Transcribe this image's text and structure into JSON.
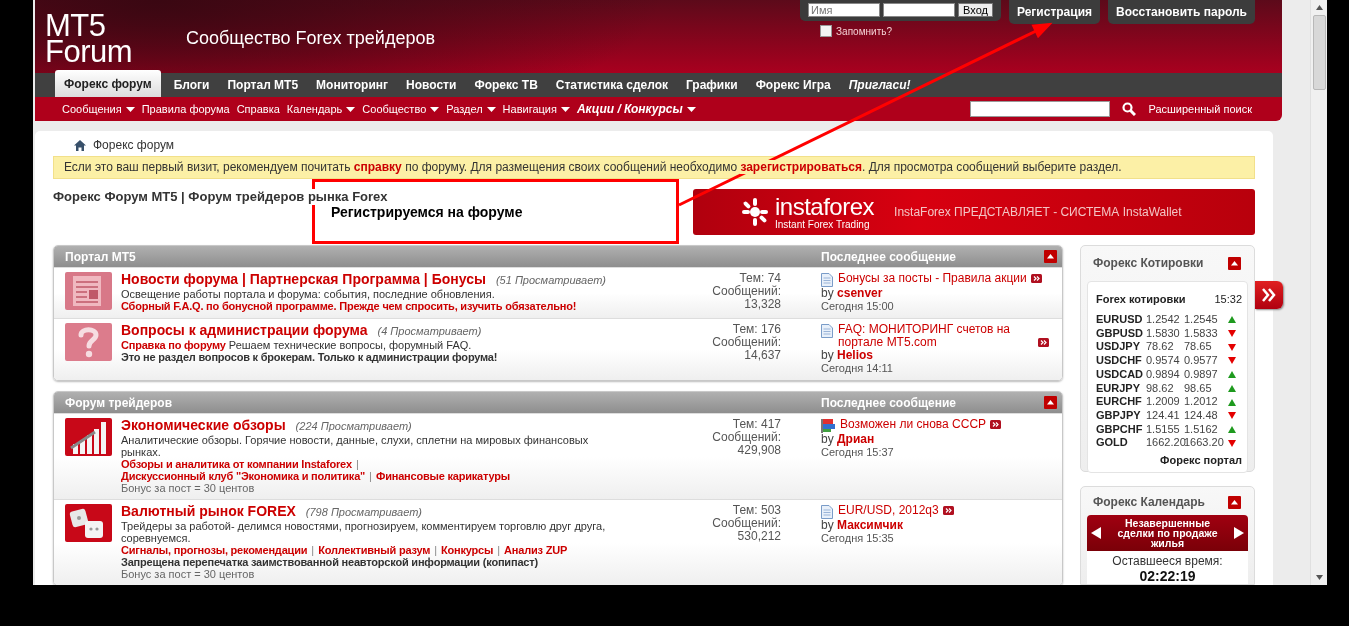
{
  "header": {
    "logo": "MT5 Forum",
    "tagline": "Сообщество Forex трейдеров",
    "login": {
      "username_placeholder": "Имя",
      "submit": "Вход",
      "remember": {
        "label": "Запомнить?",
        "checked": false
      }
    },
    "buttons": [
      "Регистрация",
      "Восстановить пароль"
    ]
  },
  "nav_tabs": [
    {
      "label": "Форекс форум",
      "selected": true,
      "kind": "link"
    },
    {
      "label": "Блоги",
      "selected": false,
      "kind": "link"
    },
    {
      "label": "Портал MT5",
      "selected": false,
      "kind": "link"
    },
    {
      "label": "Мониторинг",
      "selected": false,
      "kind": "link"
    },
    {
      "label": "Новости",
      "selected": false,
      "kind": "link"
    },
    {
      "label": "Форекс ТВ",
      "selected": false,
      "kind": "link"
    },
    {
      "label": "Статистика сделок",
      "selected": false,
      "kind": "link"
    },
    {
      "label": "Графики",
      "selected": false,
      "kind": "link"
    },
    {
      "label": "Форекс Игра",
      "selected": false,
      "kind": "link"
    },
    {
      "label": "Пригласи!",
      "selected": false,
      "kind": "promo"
    }
  ],
  "subnav": [
    {
      "label": "Сообщения",
      "dropdown": true,
      "kind": "link"
    },
    {
      "label": "Правила форума",
      "dropdown": false,
      "kind": "link"
    },
    {
      "label": "Справка",
      "dropdown": false,
      "kind": "link"
    },
    {
      "label": "Календарь",
      "dropdown": true,
      "kind": "link"
    },
    {
      "label": "Сообщество",
      "dropdown": true,
      "kind": "link"
    },
    {
      "label": "Раздел",
      "dropdown": true,
      "kind": "link"
    },
    {
      "label": "Навигация",
      "dropdown": true,
      "kind": "link"
    },
    {
      "label": "Акции / Конкурсы",
      "dropdown": true,
      "kind": "promo"
    }
  ],
  "search": {
    "advanced": "Расширенный поиск"
  },
  "breadcrumb": "Форекс форум",
  "notice": [
    {
      "kind": "text",
      "text": "Если это ваш первый визит, рекомендуем почитать "
    },
    {
      "kind": "link",
      "text": "справку"
    },
    {
      "kind": "text",
      "text": " по форуму. Для размещения своих сообщений необходимо "
    },
    {
      "kind": "link",
      "text": "зарегистрироваться"
    },
    {
      "kind": "text",
      "text": ". Для просмотра сообщений выберите раздел."
    }
  ],
  "page_title": "Форекс Форум MT5 | Форум трейдеров рынка Forex",
  "banner": {
    "brand": "instaforex",
    "slogan": "Instant Forex Trading",
    "headline": "InstaForex ПРЕДСТАВЛЯЕТ - СИСТЕМА InstaWallet"
  },
  "annotation": "Регистрируемся на форуме",
  "categories": [
    {
      "title": "Портал MT5",
      "last_post_header": "Последнее сообщение",
      "forums": [
        {
          "kind": "news",
          "title": "Новости форума | Партнерская Программа | Бонусы",
          "viewers": "(51 Просматривает)",
          "lines": [
            {
              "kind": "desc",
              "text": "Освещение работы портала и форума: события, последние обновления."
            },
            {
              "kind": "link",
              "text": "Сборный F.A.Q. по бонусной программе. Прежде чем спросить, изучить обязательно!"
            }
          ],
          "topics": "Тем: 74",
          "posts_label": "Сообщений:",
          "posts": "13,328",
          "last_post": {
            "kind": "document",
            "title": "Бонусы за посты - Правила акции",
            "by": "by",
            "author": "csenver",
            "time": "Сегодня 15:00"
          }
        },
        {
          "kind": "help",
          "title": "Вопросы к администрации форума",
          "viewers": "(4 Просматривает)",
          "lines": [
            {
              "kind": "link_desc",
              "link": "Справка по форуму",
              "text": "Решаем технические вопросы, форумный FAQ."
            },
            {
              "kind": "note",
              "text": "Это не раздел вопросов к брокерам. Только к администрации форума!"
            }
          ],
          "topics": "Тем: 176",
          "posts_label": "Сообщений:",
          "posts": "14,637",
          "last_post": {
            "kind": "document",
            "title": "FAQ: МОНИТОРИНГ счетов на портале MT5.com",
            "by": "by",
            "author": "Helios",
            "time": "Сегодня 14:11"
          }
        }
      ]
    },
    {
      "title": "Форум трейдеров",
      "last_post_header": "Последнее сообщение",
      "forums": [
        {
          "kind": "analysis",
          "title": "Экономические обзоры",
          "viewers": "(224 Просматривает)",
          "lines": [
            {
              "kind": "desc",
              "text": "Аналитические обзоры. Горячие новости, данные, слухи, сплетни на мировых финансовых рынках."
            },
            {
              "kind": "links",
              "separator": "|",
              "items": [
                "Обзоры и аналитика от компании Instaforex",
                "Дискуссионный клуб \"Экономика и политика\"",
                "Финансовые карикатуры"
              ]
            },
            {
              "kind": "bonus",
              "text": "Бонус за пост = 30 центов"
            }
          ],
          "topics": "Тем: 417",
          "posts_label": "Сообщений:",
          "posts": "429,908",
          "last_post": {
            "kind": "flag",
            "title": "Возможен ли снова СССР",
            "by": "by",
            "author": "Дриан",
            "time": "Сегодня 15:37"
          }
        },
        {
          "kind": "market",
          "title": "Валютный рынок FOREX",
          "viewers": "(798 Просматривает)",
          "lines": [
            {
              "kind": "desc",
              "text": "Трейдеры за работой- делимся новостями, прогнозируем, комментируем торговлю друг друга, соревнуемся."
            },
            {
              "kind": "links",
              "separator": "|",
              "items": [
                "Сигналы, прогнозы, рекомендации",
                "Коллективный разум",
                "Конкурсы",
                "Анализ ZUP"
              ]
            },
            {
              "kind": "note",
              "text": "Запрещена перепечатка заимствованной неавторской информации (копипаст)"
            },
            {
              "kind": "bonus",
              "text": "Бонус за пост = 30 центов"
            }
          ],
          "topics": "Тем: 503",
          "posts_label": "Сообщений:",
          "posts": "530,212",
          "last_post": {
            "kind": "document",
            "title": "EUR/USD, 2012q3",
            "by": "by",
            "author": "Максимчик",
            "time": "Сегодня 15:35"
          }
        }
      ]
    }
  ],
  "quotes": {
    "title": "Форекс Котировки",
    "heading": "Forex котировки",
    "time": "15:32",
    "rows": [
      {
        "symbol": "EURUSD",
        "bid": "1.2542",
        "ask": "1.2545",
        "rising": true
      },
      {
        "symbol": "GBPUSD",
        "bid": "1.5830",
        "ask": "1.5833",
        "rising": false
      },
      {
        "symbol": "USDJPY",
        "bid": "78.62",
        "ask": "78.65",
        "rising": false
      },
      {
        "symbol": "USDCHF",
        "bid": "0.9574",
        "ask": "0.9577",
        "rising": false
      },
      {
        "symbol": "USDCAD",
        "bid": "0.9894",
        "ask": "0.9897",
        "rising": true
      },
      {
        "symbol": "EURJPY",
        "bid": "98.62",
        "ask": "98.65",
        "rising": true
      },
      {
        "symbol": "EURCHF",
        "bid": "1.2009",
        "ask": "1.2012",
        "rising": true
      },
      {
        "symbol": "GBPJPY",
        "bid": "124.41",
        "ask": "124.48",
        "rising": false
      },
      {
        "symbol": "GBPCHF",
        "bid": "1.5155",
        "ask": "1.5162",
        "rising": true
      },
      {
        "symbol": "GOLD",
        "bid": "1662.20",
        "ask": "1663.20",
        "rising": false
      }
    ],
    "footer": "Форекс портал"
  },
  "calendar": {
    "title": "Форекс Календарь",
    "event": "Незавершенные сделки по продаже жилья",
    "remaining_label": "Оставшееся время:",
    "countdown": "02:22:19"
  }
}
